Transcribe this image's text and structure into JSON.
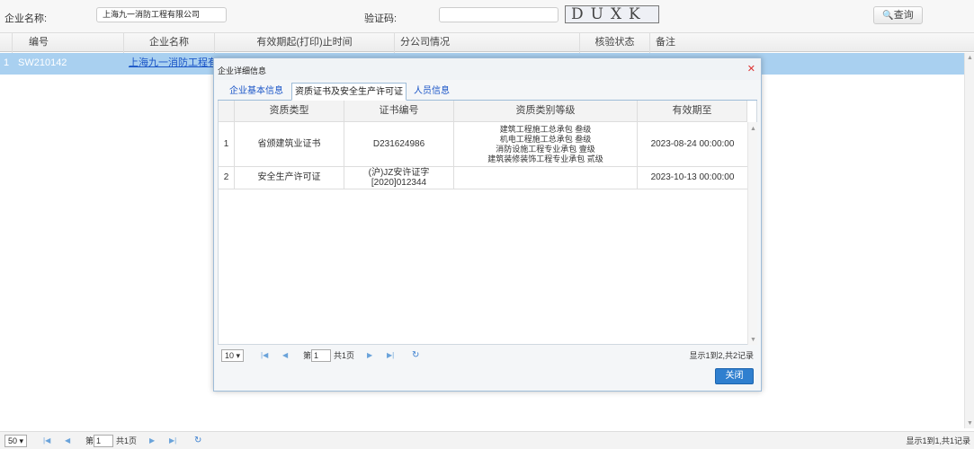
{
  "search": {
    "company_label": "企业名称:",
    "company_value": "上海九一消防工程有限公司",
    "captcha_label": "验证码:",
    "captcha_value": "",
    "captcha_text": "DUXK",
    "query_label": "查询",
    "query_icon": "search-icon"
  },
  "grid": {
    "columns": [
      "编号",
      "企业名称",
      "有效期起(打印)止时间",
      "分公司情况",
      "核验状态",
      "备注"
    ],
    "rows": [
      {
        "index": "1",
        "code": "SW210142",
        "company": "上海九一消防工程有"
      }
    ]
  },
  "pager": {
    "page_size": "50 ▾",
    "page_prefix": "第",
    "page_value": "1",
    "page_total": "共1页",
    "summary": "显示1到1,共1记录"
  },
  "dialog": {
    "title": "企业详细信息",
    "close_icon": "close-icon",
    "tabs": [
      "企业基本信息",
      "资质证书及安全生产许可证",
      "人员信息"
    ],
    "active_tab": 1,
    "table": {
      "columns": [
        "资质类型",
        "证书编号",
        "资质类别等级",
        "有效期至"
      ],
      "rows": [
        {
          "index": "1",
          "type": "省颁建筑业证书",
          "cert_no": "D231624986",
          "categories": [
            "建筑工程施工总承包 叁级",
            "机电工程施工总承包 叁级",
            "消防设施工程专业承包 壹级",
            "建筑装修装饰工程专业承包 贰级"
          ],
          "expire": "2023-08-24 00:00:00"
        },
        {
          "index": "2",
          "type": "安全生产许可证",
          "cert_no": "(沪)JZ安许证字\n[2020]012344",
          "cert_no_lines": [
            "(沪)JZ安许证字",
            "[2020]012344"
          ],
          "categories": [],
          "expire": "2023-10-13 00:00:00"
        }
      ]
    },
    "pager": {
      "page_size": "10 ▾",
      "page_prefix": "第",
      "page_value": "1",
      "page_total": "共1页",
      "summary": "显示1到2,共2记录"
    },
    "close_button": "关闭"
  },
  "colors": {
    "selected_row": "#a9d0f0",
    "link": "#1a55c7",
    "primary_button": "#2f7fcf",
    "close_x": "#dd3333"
  }
}
